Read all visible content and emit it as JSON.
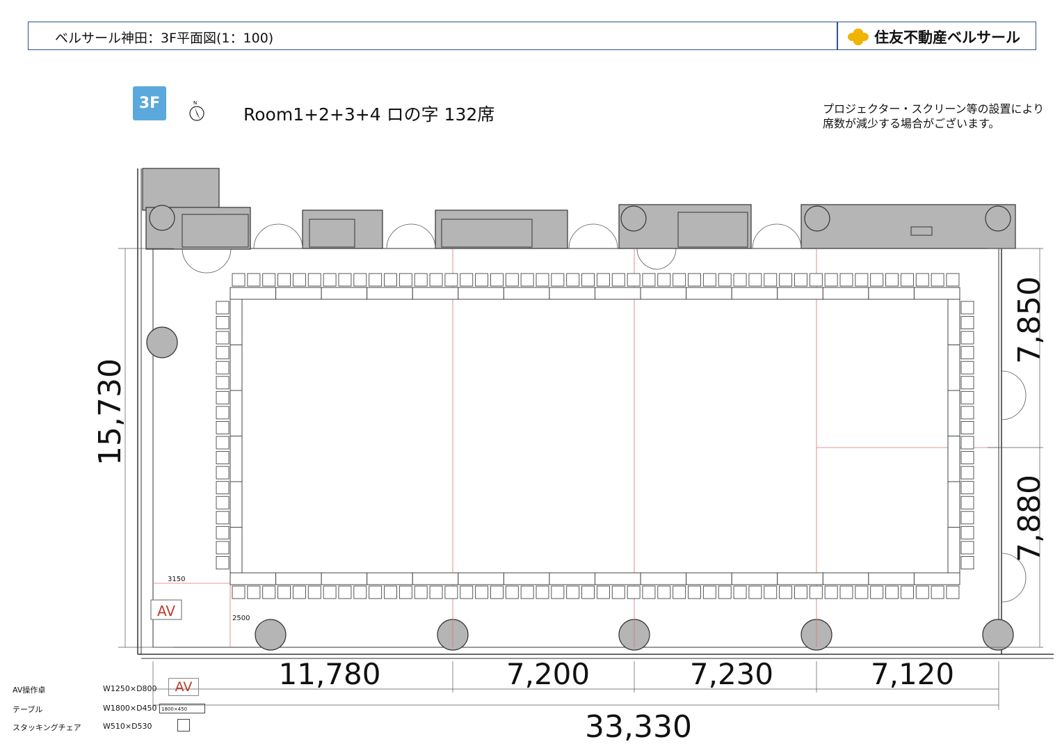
{
  "header": {
    "title": "ベルサール神田：3F平面図(1：100)",
    "brand": "住友不動産ベルサール"
  },
  "floor_badge": "3F",
  "room_title": "Room1+2+3+4 ロの字 132席",
  "note": [
    "プロジェクター・スクリーン等の設置により",
    "席数が減少する場合がございます。"
  ],
  "dimensions": {
    "height_total": "15,730",
    "right_upper": "7,850",
    "right_lower": "7,880",
    "bottom_segments": [
      "11,780",
      "7,200",
      "7,230",
      "7,120"
    ],
    "width_total": "33,330",
    "av_width": "3150",
    "av_depth": "2500"
  },
  "av_label": "AV",
  "legend": [
    {
      "name": "AV操作卓",
      "size": "W1250×D800",
      "symbol": "AV"
    },
    {
      "name": "テーブル",
      "size": "W1800×D450",
      "symbol": "1800×450"
    },
    {
      "name": "スタッキングチェア",
      "size": "W510×D530",
      "symbol": ""
    }
  ],
  "colors": {
    "header_border": "#2f4f8f",
    "badge": "#5ba8dc",
    "brand_logo": "#f0b400",
    "av_red": "#c0392b",
    "room_fill": "#b5b5b5",
    "guide_red": "#e07070"
  },
  "icons": {
    "compass": "north-arrow-icon",
    "logo": "sumitomo-logo-icon"
  }
}
